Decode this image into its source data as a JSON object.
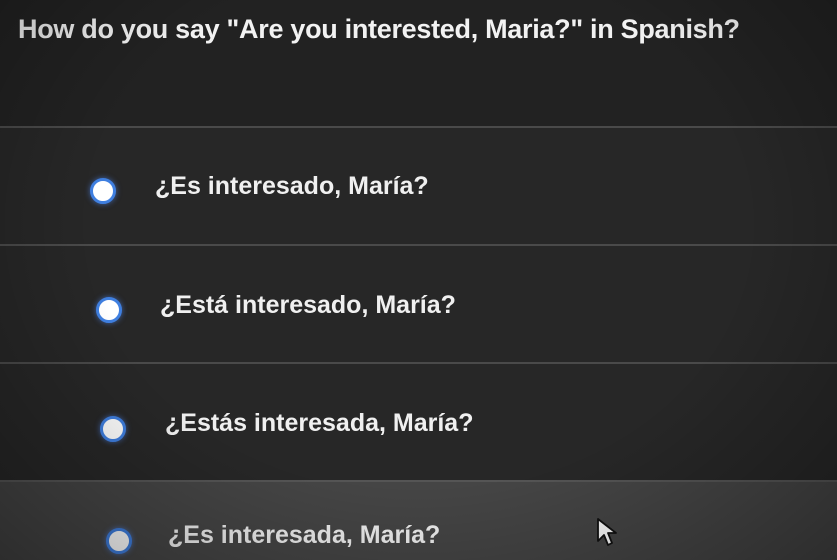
{
  "question": {
    "text": "How do you say \"Are you interested, Maria?\" in Spanish?"
  },
  "options": [
    {
      "label": "¿Es interesado, María?",
      "selected": false
    },
    {
      "label": "¿Está interesado, María?",
      "selected": false
    },
    {
      "label": "¿Estás interesada, María?",
      "selected": false
    },
    {
      "label": "¿Es interesada, María?",
      "selected": false
    }
  ],
  "colors": {
    "radio_border": "#3f7fe0",
    "hover_row": "#454545",
    "background": "#272727"
  },
  "icons": {
    "cursor": "mouse-pointer-icon",
    "radio": "radio-circle-icon"
  }
}
